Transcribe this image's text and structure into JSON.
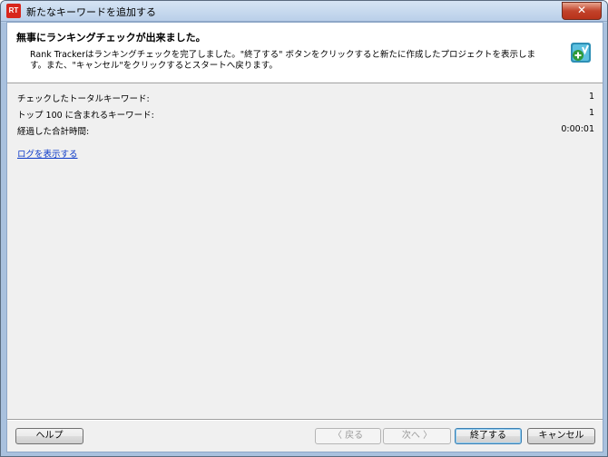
{
  "window": {
    "title": "新たなキーワードを追加する",
    "app_icon_text": "RT"
  },
  "header": {
    "title": "無事にランキングチェックが出来ました。",
    "description": "Rank Trackerはランキングチェックを完了しました。\"終了する\" ボタンをクリックすると新たに作成したプロジェクトを表示します。また、\"キャンセル\"をクリックするとスタートへ戻ります。",
    "icon": "add-keyword-icon"
  },
  "stats": [
    {
      "label": "チェックしたトータルキーワード:",
      "value": "1"
    },
    {
      "label": "トップ 100 に含まれるキーワード:",
      "value": "1"
    },
    {
      "label": "経過した合計時間:",
      "value": "0:00:01"
    }
  ],
  "log_link": "ログを表示する",
  "buttons": {
    "help": "ヘルプ",
    "back": "〈 戻る",
    "next": "次へ 〉",
    "finish": "終了する",
    "cancel": "キャンセル"
  },
  "colors": {
    "link": "#0a38c8",
    "close_button": "#c2432b",
    "icon_green": "#2e9a3a"
  }
}
